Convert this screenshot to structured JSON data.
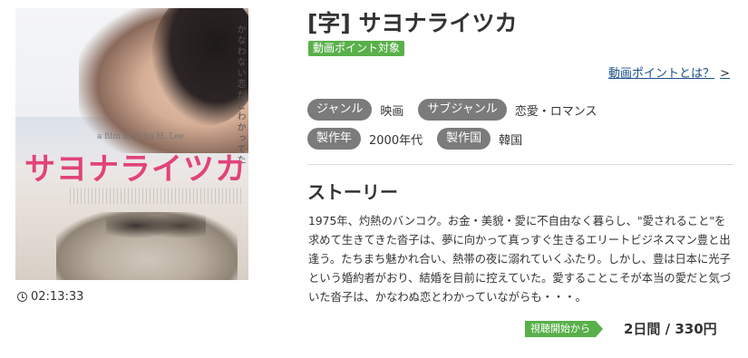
{
  "poster": {
    "vertical_tagline": "かなわない恋だとわかってた",
    "credit": "a film by John H. Lee",
    "title_art": "サヨナライツカ"
  },
  "duration": "02:13:33",
  "title": "[字] サヨナライツカ",
  "point_badge": "動画ポイント対象",
  "point_link": "動画ポイントとは？",
  "point_link_arrow": ">",
  "meta": {
    "genre_label": "ジャンル",
    "genre_value": "映画",
    "subgenre_label": "サブジャンル",
    "subgenre_value": "恋愛・ロマンス",
    "year_label": "製作年",
    "year_value": "2000年代",
    "country_label": "製作国",
    "country_value": "韓国"
  },
  "story": {
    "heading": "ストーリー",
    "text": "1975年、灼熱のバンコク。お金・美貌・愛に不自由なく暮らし、\"愛されること\"を求めて生きてきた沓子は、夢に向かって真っすぐ生きるエリートビジネスマン豊と出逢う。たちまち魅かれ合い、熱帯の夜に溺れていくふたり。しかし、豊は日本に光子という婚約者がおり、結婚を目前に控えていた。愛することこそが本当の愛だと気づいた沓子は、かなわぬ恋とわかっていながらも・・・。"
  },
  "rental": {
    "start_label": "視聴開始から",
    "price": "2日間 / 330円"
  },
  "colors": {
    "accent_green": "#59b04a",
    "pill_gray": "#7b7b7b",
    "link_blue": "#1a4f8a",
    "title_pink": "#e2427a"
  }
}
